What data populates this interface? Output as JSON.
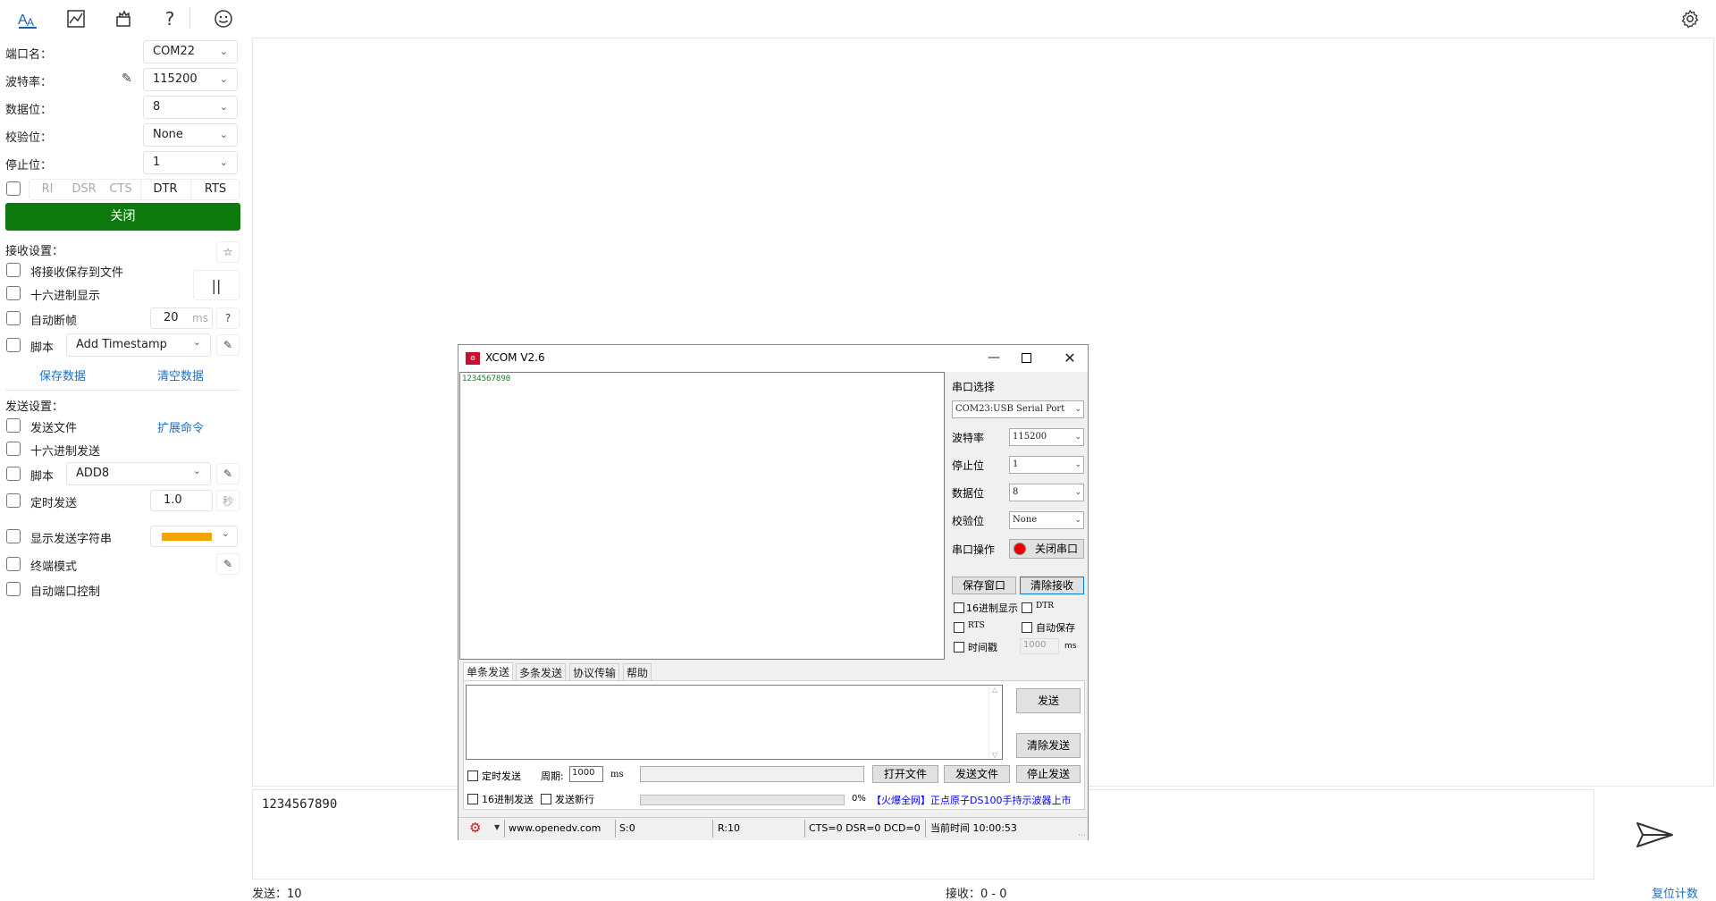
{
  "toolbar": {
    "icons": [
      "text-format-icon",
      "chart-icon",
      "plugin-icon",
      "help-icon",
      "emoji-icon"
    ],
    "help_glyph": "?",
    "settings_icon": "gear-icon"
  },
  "serial": {
    "port_label": "端口名：",
    "port_value": "COM22",
    "baud_label": "波特率：",
    "baud_value": "115200",
    "data_label": "数据位：",
    "data_value": "8",
    "parity_label": "校验位：",
    "parity_value": "None",
    "stop_label": "停止位：",
    "stop_value": "1",
    "pins": [
      "RI",
      "DSR",
      "CTS",
      "DTR",
      "RTS"
    ],
    "close_button": "关闭",
    "close_color": "#0e7a0d"
  },
  "receive": {
    "section_title": "接收设置：",
    "save_to_file": "将接收保存到文件",
    "hex_display": "十六进制显示",
    "auto_frame": "自动断帧",
    "frame_ms_value": "20",
    "frame_ms_unit": "ms",
    "help_glyph": "?",
    "pause_glyph": "||",
    "script_label": "脚本",
    "script_value": "Add Timestamp",
    "save_data": "保存数据",
    "clear_data": "清空数据"
  },
  "send": {
    "section_title": "发送设置：",
    "send_file": "发送文件",
    "extend_cmd": "扩展命令",
    "hex_send": "十六进制发送",
    "script_label": "脚本",
    "script_value": "ADD8",
    "timed_send": "定时发送",
    "interval_value": "1.0",
    "interval_unit": "秒",
    "show_send_string": "显示发送字符串",
    "send_string_color": "#f5a300",
    "terminal_mode": "终端模式",
    "auto_port_control": "自动端口控制"
  },
  "main": {
    "input_text": "1234567890",
    "sent_count": "发送：10",
    "recv_count": "接收：0 - 0",
    "reset_count": "复位计数"
  },
  "xcom": {
    "title": "XCOM V2.6",
    "received": "1234567890",
    "port_select_label": "串口选择",
    "port_value": "COM23:USB Serial Port",
    "baud_label": "波特率",
    "baud_value": "115200",
    "stop_label": "停止位",
    "stop_value": "1",
    "data_label": "数据位",
    "data_value": "8",
    "parity_label": "校验位",
    "parity_value": "None",
    "op_label": "串口操作",
    "close_port": "关闭串口",
    "save_window": "保存窗口",
    "clear_recv": "清除接收",
    "hex_display": "16进制显示",
    "dtr": "DTR",
    "rts": "RTS",
    "auto_save": "自动保存",
    "timestamp": "时间戳",
    "ts_value": "1000",
    "ts_unit": "ms",
    "tabs": [
      "单条发送",
      "多条发送",
      "协议传输",
      "帮助"
    ],
    "send_button": "发送",
    "clear_send": "清除发送",
    "timed_send": "定时发送",
    "period_label": "周期:",
    "period_value": "1000",
    "period_unit": "ms",
    "open_file": "打开文件",
    "send_file": "发送文件",
    "stop_send": "停止发送",
    "hex_send": "16进制发送",
    "send_newline": "发送新行",
    "progress": "0%",
    "ad": "【火爆全网】正点原子DS100手持示波器上市",
    "status_url": "www.openedv.com",
    "status_s": "S:0",
    "status_r": "R:10",
    "status_lines": "CTS=0 DSR=0 DCD=0",
    "status_time": "当前时间 10:00:53"
  }
}
